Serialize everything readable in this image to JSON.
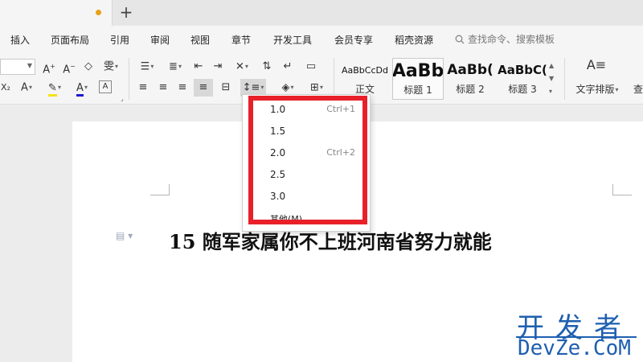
{
  "tabbar": {
    "add_label": "+"
  },
  "menu": {
    "items": [
      "插入",
      "页面布局",
      "引用",
      "审阅",
      "视图",
      "章节",
      "开发工具",
      "会员专享",
      "稻壳资源"
    ],
    "search_placeholder": "查找命令、搜索模板"
  },
  "ribbon": {
    "styles": [
      {
        "sample": "AaBbCcDd",
        "name": "正文"
      },
      {
        "sample": "AaBb",
        "name": "标题 1"
      },
      {
        "sample": "AaBb(",
        "name": "标题 2"
      },
      {
        "sample": "AaBbC(",
        "name": "标题 3"
      }
    ],
    "text_layout_label": "文字排版",
    "cut_off_label": "查"
  },
  "line_spacing_menu": {
    "options": [
      {
        "value": "1.0",
        "shortcut": "Ctrl+1"
      },
      {
        "value": "1.5",
        "shortcut": ""
      },
      {
        "value": "2.0",
        "shortcut": "Ctrl+2"
      },
      {
        "value": "2.5",
        "shortcut": ""
      },
      {
        "value": "3.0",
        "shortcut": ""
      },
      {
        "value": "其他(M)...",
        "shortcut": ""
      }
    ]
  },
  "document": {
    "heading": "15 随军家属你不上班河南省努力就能"
  },
  "watermark": {
    "cn": "开发者",
    "en": "DevZe.CoM"
  },
  "colors": {
    "highlight": "#e8202a",
    "watermark": "#1e5fb0",
    "tab_dot": "#e8a21a"
  }
}
